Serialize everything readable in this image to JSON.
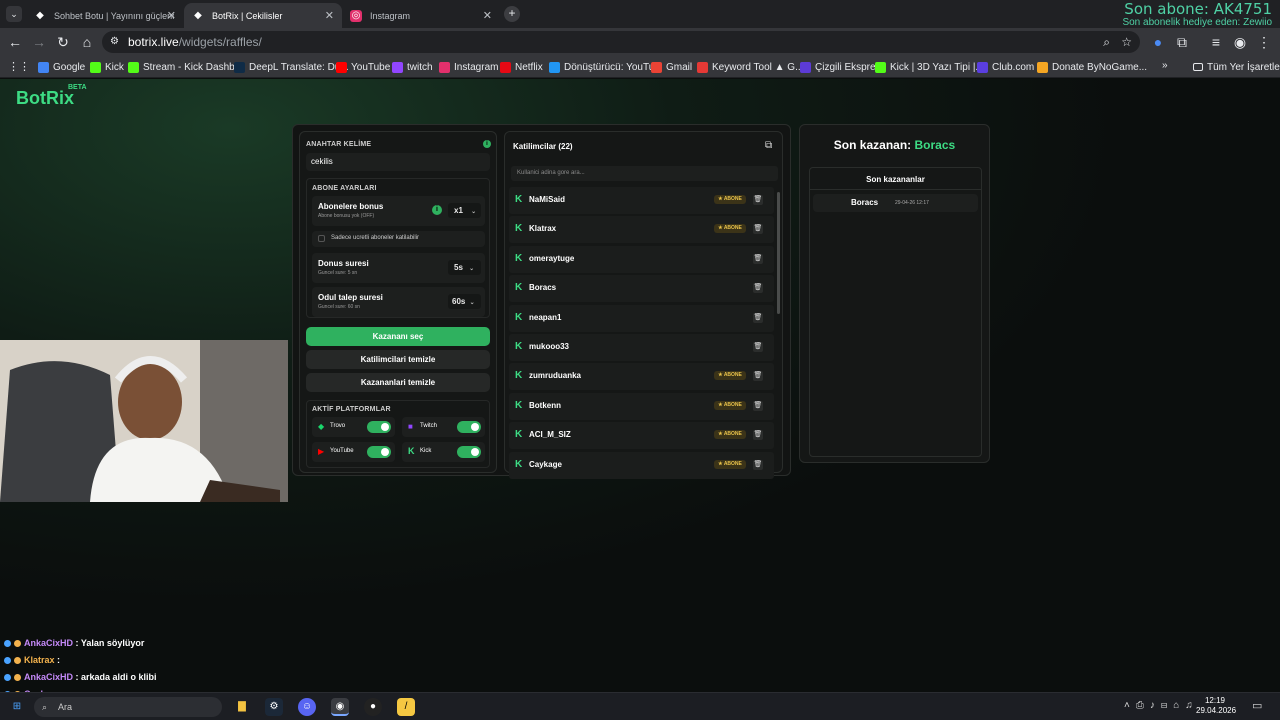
{
  "browser": {
    "tabs": [
      {
        "label": "Sohbet Botu | Yayınını güçlendi"
      },
      {
        "label": "BotRix | Cekilisler"
      },
      {
        "label": "Instagram"
      }
    ],
    "url_host": "botrix.live",
    "url_path": "/widgets/raffles/",
    "bookmarks": [
      {
        "label": "Google",
        "icon": "google-icon",
        "color": "#4285f4"
      },
      {
        "label": "Kick",
        "icon": "kick-icon",
        "color": "#53fc18"
      },
      {
        "label": "Stream - Kick Dashb...",
        "icon": "kick-icon",
        "color": "#53fc18"
      },
      {
        "label": "DeepL Translate: Dü...",
        "icon": "deepl-icon",
        "color": "#0f2b46"
      },
      {
        "label": "YouTube",
        "icon": "youtube-icon",
        "color": "#ff0000"
      },
      {
        "label": "twitch",
        "icon": "twitch-icon",
        "color": "#9146ff"
      },
      {
        "label": "Instagram",
        "icon": "instagram-icon",
        "color": "#e1306c"
      },
      {
        "label": "Netflix",
        "icon": "netflix-icon",
        "color": "#e50914"
      },
      {
        "label": "Dönüştürücü: YouTu...",
        "icon": "converter-icon",
        "color": "#2196f3"
      },
      {
        "label": "Gmail",
        "icon": "gmail-icon",
        "color": "#ea4335"
      },
      {
        "label": "Keyword Tool ▲ G...",
        "icon": "keyword-icon",
        "color": "#e53935"
      },
      {
        "label": "Çizgili Ekspres",
        "icon": "crunchyroll-icon",
        "color": "#5c3bd6"
      },
      {
        "label": "Kick | 3D Yazı Tipi |...",
        "icon": "kick-icon",
        "color": "#53fc18"
      },
      {
        "label": "Club.com",
        "icon": "club-icon",
        "color": "#5a3ee0"
      },
      {
        "label": "Donate ByNoGame...",
        "icon": "donate-icon",
        "color": "#f5a623"
      }
    ],
    "all_bookmarks_label": "Tüm Yer İşaretleri"
  },
  "overlay": {
    "last_sub": "Son abone: AK4751",
    "last_gift": "Son abonelik hediye eden: Zewiio"
  },
  "app": {
    "logo": "BotRix",
    "logo_badge": "BETA"
  },
  "settings": {
    "keyword_title": "ANAHTAR KELİME",
    "keyword_value": "cekilis",
    "sub_settings_title": "ABONE AYARLARI",
    "sub_bonus_label": "Abonelere bonus",
    "sub_bonus_sub": "Abone bonusu yok (OFF)",
    "sub_bonus_value": "x1",
    "only_subs_label": "Sadece ucretli aboneler katilabilir",
    "spin_label": "Donus suresi",
    "spin_sub": "Guncel sure: 5 sn",
    "spin_value": "5s",
    "claim_label": "Odul talep suresi",
    "claim_sub": "Guncel sure: 60 sn",
    "claim_value": "60s",
    "pick_winner": "Kazananı seç",
    "clear_participants": "Katilimcilari temizle",
    "clear_winners": "Kazananlari temizle",
    "platforms_title": "AKTİF PLATFORMLAR",
    "platforms": [
      {
        "label": "Trovo",
        "icon": "trovo-icon",
        "enabled": true
      },
      {
        "label": "Twitch",
        "icon": "twitch-icon",
        "enabled": true
      },
      {
        "label": "YouTube",
        "icon": "youtube-icon",
        "enabled": true
      },
      {
        "label": "Kick",
        "icon": "kick-icon",
        "enabled": true
      }
    ]
  },
  "participants": {
    "title": "Katilimcilar (22)",
    "search_placeholder": "Kullanici adina gore ara...",
    "badge_label": "ABONE",
    "items": [
      {
        "name": "NaMiSaid",
        "sub": true
      },
      {
        "name": "Klatrax",
        "sub": true
      },
      {
        "name": "omeraytuge",
        "sub": false
      },
      {
        "name": "Boracs",
        "sub": false
      },
      {
        "name": "neapan1",
        "sub": false
      },
      {
        "name": "mukooo33",
        "sub": false
      },
      {
        "name": "zumruduanka",
        "sub": true
      },
      {
        "name": "Botkenn",
        "sub": true
      },
      {
        "name": "ACI_M_SIZ",
        "sub": true
      },
      {
        "name": "Caykage",
        "sub": true
      }
    ]
  },
  "winners": {
    "title_prefix": "Son kazanan:",
    "title_name": "Boracs",
    "list_title": "Son kazananlar",
    "items": [
      {
        "name": "Boracs",
        "date": "29-04-26 12:17"
      }
    ]
  },
  "chat": [
    {
      "user": "AnkaCixHD",
      "msg": ": Yalan söylüyor",
      "color": "#c58af9"
    },
    {
      "user": "Klatrax",
      "msg": ":",
      "color": "#f3b24d"
    },
    {
      "user": "AnkaCixHD",
      "msg": ": arkada aldi o klibi",
      "color": "#c58af9"
    },
    {
      "user": "Caykage",
      "msg": ":",
      "color": "#c58af9"
    }
  ],
  "taskbar": {
    "search_label": "Ara",
    "time": "12:19",
    "date": "29.04.2026"
  }
}
